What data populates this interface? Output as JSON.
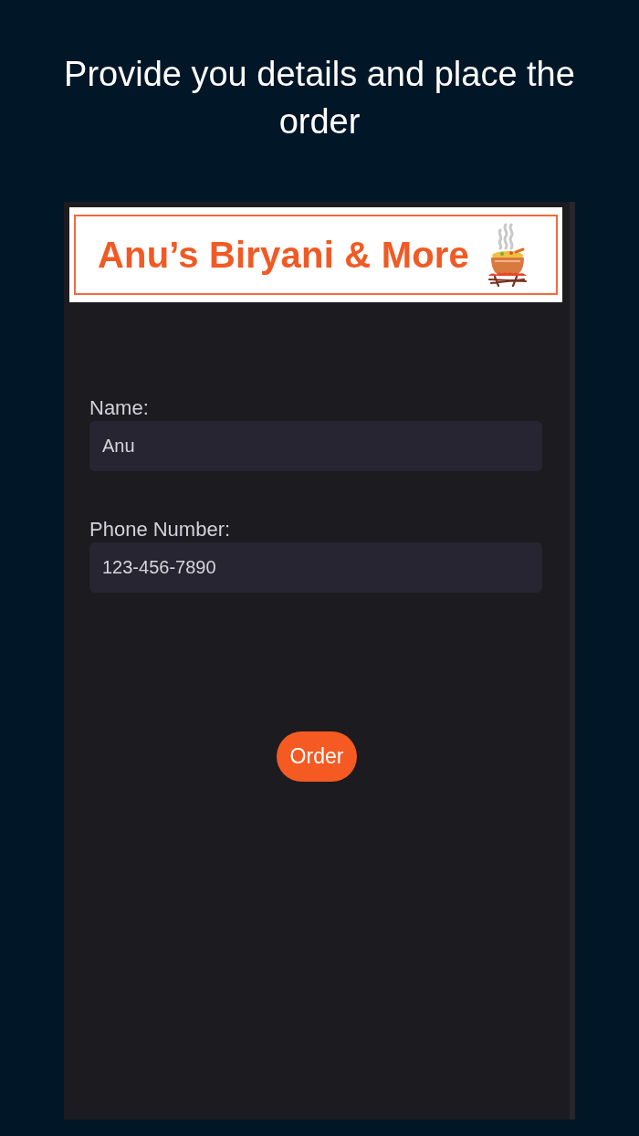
{
  "headline": "Provide you details and place the order",
  "banner": {
    "title": "Anu’s Biryani & More"
  },
  "fields": [
    {
      "label": "Name:",
      "value": "Anu"
    },
    {
      "label": "Phone Number:",
      "value": "123-456-7890"
    }
  ],
  "order_button": {
    "label": "Order"
  }
}
